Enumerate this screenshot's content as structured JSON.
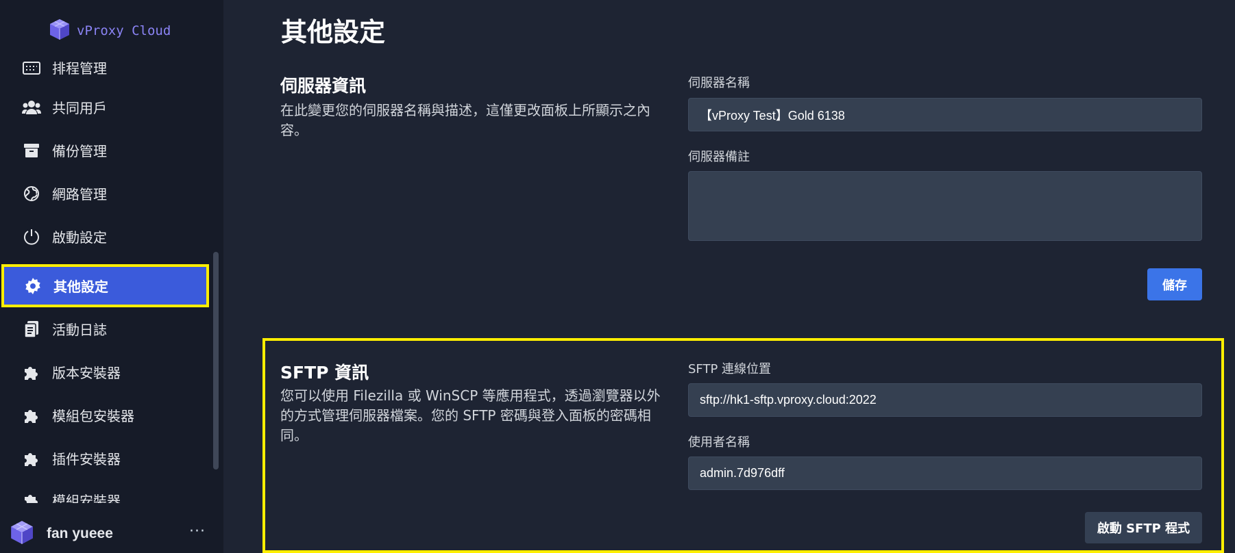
{
  "app": {
    "brand": "vProxy Cloud",
    "accent": "#3b5bdb",
    "highlight": "#ffee00"
  },
  "sidebar": {
    "items": [
      {
        "label": "排程管理",
        "icon": "calendar-icon"
      },
      {
        "label": "共同用戶",
        "icon": "users-icon"
      },
      {
        "label": "備份管理",
        "icon": "archive-icon"
      },
      {
        "label": "網路管理",
        "icon": "globe-icon"
      },
      {
        "label": "啟動設定",
        "icon": "power-icon"
      },
      {
        "label": "其他設定",
        "icon": "gear-icon",
        "active": true
      },
      {
        "label": "活動日誌",
        "icon": "log-icon"
      },
      {
        "label": "版本安裝器",
        "icon": "puzzle-icon"
      },
      {
        "label": "模組包安裝器",
        "icon": "puzzle-icon"
      },
      {
        "label": "插件安裝器",
        "icon": "puzzle-icon"
      },
      {
        "label": "模組安裝器",
        "icon": "puzzle-icon"
      }
    ],
    "user": {
      "name": "fan yueee",
      "more": "···"
    }
  },
  "main": {
    "title": "其他設定",
    "server_info": {
      "title": "伺服器資訊",
      "description": "在此變更您的伺服器名稱與描述，這僅更改面板上所顯示之內容。",
      "name_label": "伺服器名稱",
      "name_value": "【vProxy Test】Gold 6138",
      "note_label": "伺服器備註",
      "note_value": "",
      "save_label": "儲存"
    },
    "sftp_info": {
      "title": "SFTP 資訊",
      "description": "您可以使用 Filezilla 或 WinSCP 等應用程式，透過瀏覽器以外的方式管理伺服器檔案。您的 SFTP 密碼與登入面板的密碼相同。",
      "address_label": "SFTP 連線位置",
      "address_value": "sftp://hk1-sftp.vproxy.cloud:2022",
      "username_label": "使用者名稱",
      "username_value": "admin.7d976dff",
      "launch_label": "啟動 SFTP 程式"
    }
  }
}
